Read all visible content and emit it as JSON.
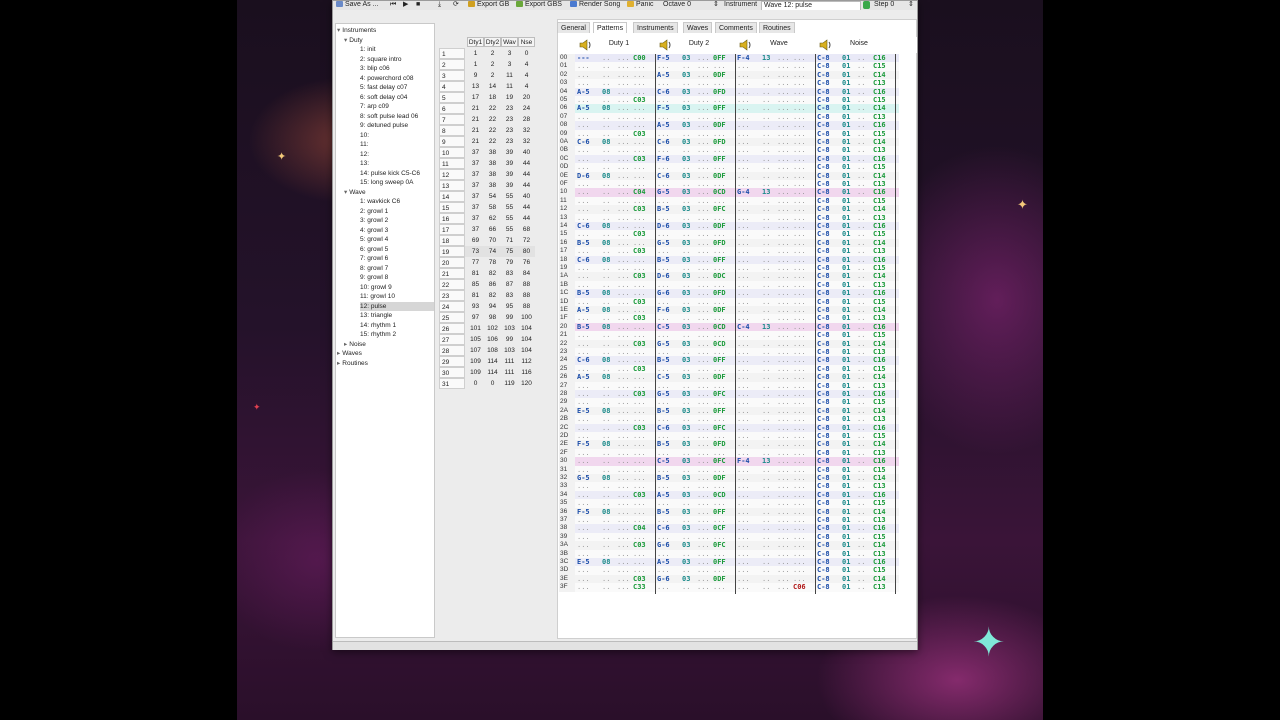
{
  "toolbar": {
    "save_as": "Save As ...",
    "export_gb": "Export GB",
    "export_gbs": "Export GBS",
    "render_song": "Render Song",
    "panic": "Panic",
    "octave": "Octave 0",
    "instrument": "Instrument",
    "instrument_value": "Wave 12: pulse",
    "step": "Step 0"
  },
  "tree": {
    "instruments": "Instruments",
    "duty": "Duty",
    "duty_items": [
      "1: init",
      "2: square intro",
      "3: blip c06",
      "4: powerchord c08",
      "5: fast delay c07",
      "6: soft delay c04",
      "7: arp c09",
      "8: soft pulse lead 06",
      "9: detuned pulse",
      "10:",
      "11:",
      "12:",
      "13:",
      "14: pulse kick C5-C6",
      "15: long sweep 0A"
    ],
    "wave": "Wave",
    "wave_items": [
      "1: wavkick C6",
      "2: growl 1",
      "3: growl 2",
      "4: growl 3",
      "5: growl 4",
      "6: growl 5",
      "7: growl 6",
      "8: growl 7",
      "9: growl 8",
      "10: growl 9",
      "11: growl 10",
      "12: pulse",
      "13: triangle",
      "14: rhythm 1",
      "15: rhythm 2"
    ],
    "noise": "Noise",
    "waves": "Waves",
    "routines": "Routines"
  },
  "inst_table": {
    "headers": [
      "Dty1",
      "Dty2",
      "Wav",
      "Nse"
    ],
    "rows": [
      [
        "1",
        "2",
        "3",
        "0"
      ],
      [
        "1",
        "2",
        "3",
        "4"
      ],
      [
        "9",
        "2",
        "11",
        "4"
      ],
      [
        "13",
        "14",
        "11",
        "4"
      ],
      [
        "17",
        "18",
        "19",
        "20"
      ],
      [
        "21",
        "22",
        "23",
        "24"
      ],
      [
        "21",
        "22",
        "23",
        "28"
      ],
      [
        "21",
        "22",
        "23",
        "32"
      ],
      [
        "21",
        "22",
        "23",
        "32"
      ],
      [
        "37",
        "38",
        "39",
        "40"
      ],
      [
        "37",
        "38",
        "39",
        "44"
      ],
      [
        "37",
        "38",
        "39",
        "44"
      ],
      [
        "37",
        "38",
        "39",
        "44"
      ],
      [
        "37",
        "54",
        "55",
        "40"
      ],
      [
        "37",
        "58",
        "55",
        "44"
      ],
      [
        "37",
        "62",
        "55",
        "44"
      ],
      [
        "37",
        "66",
        "55",
        "68"
      ],
      [
        "69",
        "70",
        "71",
        "72"
      ],
      [
        "73",
        "74",
        "75",
        "80"
      ],
      [
        "77",
        "78",
        "79",
        "76"
      ],
      [
        "81",
        "82",
        "83",
        "84"
      ],
      [
        "85",
        "86",
        "87",
        "88"
      ],
      [
        "81",
        "82",
        "83",
        "88"
      ],
      [
        "93",
        "94",
        "95",
        "88"
      ],
      [
        "97",
        "98",
        "99",
        "100"
      ],
      [
        "101",
        "102",
        "103",
        "104"
      ],
      [
        "105",
        "106",
        "99",
        "104"
      ],
      [
        "107",
        "108",
        "103",
        "104"
      ],
      [
        "109",
        "114",
        "111",
        "112"
      ],
      [
        "109",
        "114",
        "111",
        "116"
      ],
      [
        "0",
        "0",
        "119",
        "120"
      ]
    ]
  },
  "tabs": [
    "General",
    "Patterns",
    "Instruments",
    "Waves",
    "Comments",
    "Routines"
  ],
  "channels": [
    "Duty 1",
    "Duty 2",
    "Wave",
    "Noise"
  ],
  "pattern": {
    "d1": {
      "0": [
        "---",
        "",
        "",
        "C00"
      ],
      "4": [
        "A-5",
        "08",
        "",
        ""
      ],
      "5": [
        "",
        "",
        "",
        "C03"
      ],
      "6": [
        "A-5",
        "08",
        "",
        ""
      ],
      "9": [
        "",
        "",
        "",
        "C03"
      ],
      "10": [
        "C-6",
        "08",
        "",
        ""
      ],
      "12": [
        "",
        "",
        "",
        "C03"
      ],
      "14": [
        "D-6",
        "08",
        "",
        ""
      ],
      "16": [
        "",
        "",
        "",
        "C04"
      ],
      "18": [
        "",
        "",
        "",
        "C03"
      ],
      "20": [
        "C-6",
        "08",
        "",
        ""
      ],
      "21": [
        "",
        "",
        "",
        "C03"
      ],
      "22": [
        "B-5",
        "08",
        "",
        ""
      ],
      "23": [
        "",
        "",
        "",
        "C03"
      ],
      "24": [
        "C-6",
        "08",
        "",
        ""
      ],
      "26": [
        "",
        "",
        "",
        "C03"
      ],
      "28": [
        "B-5",
        "08",
        "",
        ""
      ],
      "29": [
        "",
        "",
        "",
        "C03"
      ],
      "30": [
        "A-5",
        "08",
        "",
        ""
      ],
      "31": [
        "",
        "",
        "",
        "C03"
      ],
      "32": [
        "B-5",
        "08",
        "",
        ""
      ],
      "34": [
        "",
        "",
        "",
        "C03"
      ],
      "36": [
        "C-6",
        "08",
        "",
        ""
      ],
      "37": [
        "",
        "",
        "",
        "C03"
      ],
      "38": [
        "A-5",
        "08",
        "",
        ""
      ],
      "40": [
        "",
        "",
        "",
        "C03"
      ],
      "42": [
        "E-5",
        "08",
        "",
        ""
      ],
      "44": [
        "",
        "",
        "",
        "C03"
      ],
      "46": [
        "F-5",
        "08",
        "",
        ""
      ],
      "50": [
        "G-5",
        "08",
        "",
        ""
      ],
      "52": [
        "",
        "",
        "",
        "C03"
      ],
      "54": [
        "F-5",
        "08",
        "",
        ""
      ],
      "56": [
        "",
        "",
        "",
        "C04"
      ],
      "58": [
        "",
        "",
        "",
        "C03"
      ],
      "60": [
        "E-5",
        "08",
        "",
        ""
      ],
      "62": [
        "",
        "",
        "",
        "C03"
      ],
      "63": [
        "",
        "",
        "",
        "C33"
      ]
    },
    "d2": {
      "0": [
        "F-5",
        "03",
        "",
        "0FF"
      ],
      "2": [
        "A-5",
        "03",
        "",
        "0DF"
      ],
      "4": [
        "C-6",
        "03",
        "",
        "0FD"
      ],
      "6": [
        "F-5",
        "03",
        "",
        "0FF"
      ],
      "8": [
        "A-5",
        "03",
        "",
        "0DF"
      ],
      "10": [
        "C-6",
        "03",
        "",
        "0FD"
      ],
      "12": [
        "F-6",
        "03",
        "",
        "0FF"
      ],
      "14": [
        "C-6",
        "03",
        "",
        "0DF"
      ],
      "16": [
        "G-5",
        "03",
        "",
        "0CD"
      ],
      "18": [
        "B-5",
        "03",
        "",
        "0FC"
      ],
      "20": [
        "D-6",
        "03",
        "",
        "0DF"
      ],
      "22": [
        "G-5",
        "03",
        "",
        "0FD"
      ],
      "24": [
        "B-5",
        "03",
        "",
        "0FF"
      ],
      "26": [
        "D-6",
        "03",
        "",
        "0DC"
      ],
      "28": [
        "G-6",
        "03",
        "",
        "0FD"
      ],
      "30": [
        "F-6",
        "03",
        "",
        "0DF"
      ],
      "32": [
        "C-5",
        "03",
        "",
        "0CD"
      ],
      "34": [
        "G-5",
        "03",
        "",
        "0CD"
      ],
      "36": [
        "B-5",
        "03",
        "",
        "0FF"
      ],
      "38": [
        "C-5",
        "03",
        "",
        "0DF"
      ],
      "40": [
        "G-5",
        "03",
        "",
        "0FC"
      ],
      "42": [
        "B-5",
        "03",
        "",
        "0FF"
      ],
      "44": [
        "C-6",
        "03",
        "",
        "0FC"
      ],
      "46": [
        "B-5",
        "03",
        "",
        "0FD"
      ],
      "48": [
        "C-5",
        "03",
        "",
        "0FC"
      ],
      "50": [
        "B-5",
        "03",
        "",
        "0DF"
      ],
      "52": [
        "A-5",
        "03",
        "",
        "0CD"
      ],
      "54": [
        "B-5",
        "03",
        "",
        "0FF"
      ],
      "56": [
        "C-6",
        "03",
        "",
        "0CF"
      ],
      "58": [
        "G-6",
        "03",
        "",
        "0FC"
      ],
      "60": [
        "A-5",
        "03",
        "",
        "0FF"
      ],
      "62": [
        "G-6",
        "03",
        "",
        "0DF"
      ]
    },
    "wv": {
      "0": [
        "F-4",
        "13",
        ""
      ],
      "16": [
        "G-4",
        "13",
        ""
      ],
      "32": [
        "C-4",
        "13",
        ""
      ],
      "48": [
        "F-4",
        "13",
        ""
      ],
      "63": [
        "",
        "",
        "C06"
      ]
    },
    "ns": [
      "C16",
      "C15",
      "C14",
      "C13"
    ]
  }
}
